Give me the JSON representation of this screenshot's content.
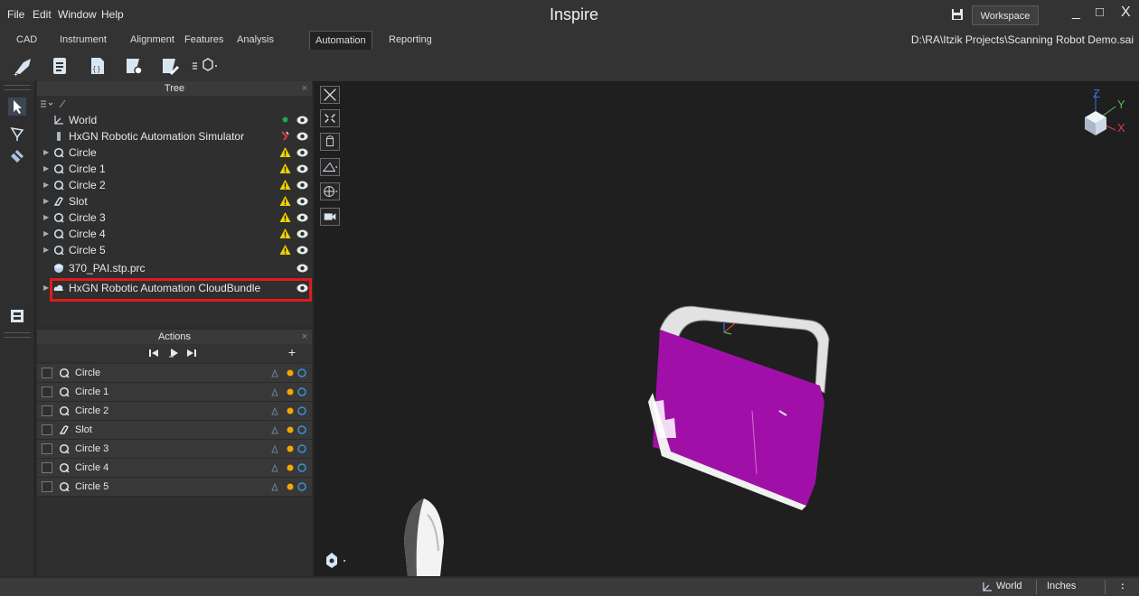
{
  "menu": {
    "file": "File",
    "edit": "Edit",
    "window": "Window",
    "help": "Help"
  },
  "app": {
    "title": "Inspire",
    "workspace_label": "Workspace",
    "file_path": "D:\\RA\\Itzik Projects\\Scanning Robot Demo.sai"
  },
  "window_controls": {
    "minimize": "_",
    "maximize": "□",
    "close": "X"
  },
  "tabs": [
    "CAD",
    "Instrument",
    "Alignment",
    "Features",
    "Analysis",
    "Automation",
    "Reporting"
  ],
  "active_tab": "Automation",
  "tree": {
    "title": "Tree",
    "close": "×",
    "items": [
      {
        "label": "World"
      },
      {
        "label": "HxGN Robotic Automation Simulator"
      },
      {
        "label": "Circle"
      },
      {
        "label": "Circle 1"
      },
      {
        "label": "Circle 2"
      },
      {
        "label": "Slot"
      },
      {
        "label": "Circle 3"
      },
      {
        "label": "Circle 4"
      },
      {
        "label": "Circle 5"
      },
      {
        "label": "370_PAI.stp.prc"
      },
      {
        "label": "HxGN Robotic Automation CloudBundle"
      }
    ]
  },
  "actions": {
    "title": "Actions",
    "close": "×",
    "add": "+",
    "items": [
      {
        "label": "Circle"
      },
      {
        "label": "Circle 1"
      },
      {
        "label": "Circle 2"
      },
      {
        "label": "Slot"
      },
      {
        "label": "Circle 3"
      },
      {
        "label": "Circle 4"
      },
      {
        "label": "Circle 5"
      }
    ]
  },
  "viewcube": {
    "x": "X",
    "y": "Y",
    "z": "Z"
  },
  "status": {
    "coord_system": "World",
    "units": "Inches"
  },
  "colors": {
    "accent": "#e01b1b",
    "part": "#a010a8",
    "warning": "#f2d200",
    "panel": "#2f2f2f",
    "viewport": "#1f1f1f"
  }
}
